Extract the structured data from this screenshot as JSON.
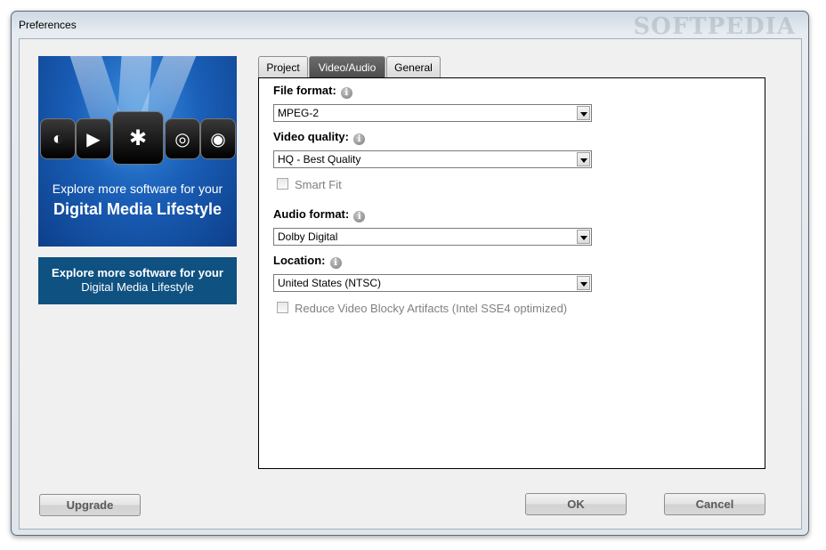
{
  "window": {
    "title": "Preferences",
    "watermark": "SOFTPEDIA"
  },
  "promo": {
    "line1": "Explore more software for your",
    "line2": "Digital Media Lifestyle"
  },
  "banner": {
    "line1": "Explore more software for your",
    "line2": "Digital Media Lifestyle"
  },
  "tabs": [
    {
      "label": "Project",
      "active": false
    },
    {
      "label": "Video/Audio",
      "active": true
    },
    {
      "label": "General",
      "active": false
    }
  ],
  "form": {
    "file_format": {
      "label": "File format:",
      "value": "MPEG-2"
    },
    "video_quality": {
      "label": "Video quality:",
      "value": "HQ - Best Quality"
    },
    "smart_fit": {
      "label": "Smart Fit",
      "checked": false
    },
    "audio_format": {
      "label": "Audio format:",
      "value": "Dolby Digital"
    },
    "location": {
      "label": "Location:",
      "value": "United States (NTSC)"
    },
    "reduce_artifacts": {
      "label": "Reduce Video Blocky Artifacts (Intel SSE4 optimized)",
      "checked": false
    }
  },
  "buttons": {
    "upgrade": "Upgrade",
    "ok": "OK",
    "cancel": "Cancel"
  }
}
